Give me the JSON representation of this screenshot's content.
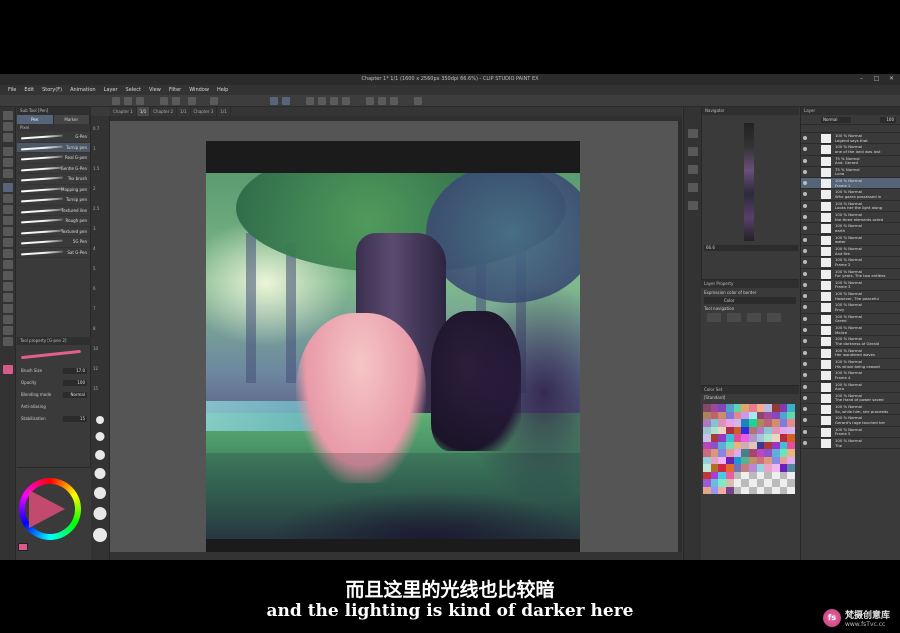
{
  "window": {
    "title": "Chapter 1* 1/1 (1600 x 2560px 350dpi 66.6%) - CLIP STUDIO PAINT EX"
  },
  "menu": [
    "File",
    "Edit",
    "Story(F)",
    "Animation",
    "Layer",
    "Select",
    "View",
    "Filter",
    "Window",
    "Help"
  ],
  "tabs": [
    "Chapter 1",
    "1/1",
    "Chapter 2",
    "1/1",
    "Chapter 3",
    "1/1"
  ],
  "subtool": {
    "header": "Sub Tool [Pen]",
    "tabs": [
      "Pen",
      "Marker"
    ],
    "group": "Pixel",
    "brushes": [
      "G-Pen",
      "Turnip pen",
      "Real G-pen",
      "Gentle G-Pen",
      "Tex brush",
      "Mapping pen",
      "Turnip pen",
      "Textured line",
      "Rough pen",
      "Textured pen",
      "5G Pen",
      "Sat G-Pen"
    ]
  },
  "tool_property": {
    "header": "Tool property [G-pen 2]",
    "brush_size_label": "Brush Size",
    "brush_size_value": "17.0",
    "opacity_label": "Opacity",
    "opacity_value": "100",
    "blending_label": "Blending mode",
    "blending_value": "Normal",
    "antialias_label": "Anti-aliasing",
    "stabilization_label": "Stabilization",
    "stabilization_value": "15"
  },
  "brush_sizes": [
    "0.7",
    "1",
    "1.5",
    "2",
    "2.5",
    "3",
    "4",
    "5",
    "6",
    "7",
    "8",
    "10",
    "12",
    "15"
  ],
  "navigator": {
    "header": "Navigator",
    "zoom": "66.6"
  },
  "layer_property": {
    "header": "Layer Property",
    "expression_label": "Expression color of border",
    "expression_value": "Color",
    "tool_nav_label": "Tool navigation"
  },
  "color_set": {
    "header": "Color Set",
    "name": "[Standard]"
  },
  "layers": {
    "header": "Layer",
    "blend": "Normal",
    "opacity": "100",
    "items": [
      {
        "line1": "100 % Normal",
        "line2": "Legend says that"
      },
      {
        "line1": "100 % Normal",
        "line2": "one of the land was lost"
      },
      {
        "line1": "75 % Normal",
        "line2": "And. Gerard"
      },
      {
        "line1": "75 % Normal",
        "line2": "Luna"
      },
      {
        "line1": "100 % Normal",
        "line2": "Frame 1"
      },
      {
        "line1": "100 % Normal",
        "line2": "Who gazes possessed in"
      },
      {
        "line1": "100 % Normal",
        "line2": "Looks her the light along"
      },
      {
        "line1": "100 % Normal",
        "line2": "the three elements acted"
      },
      {
        "line1": "100 % Normal",
        "line2": "earth"
      },
      {
        "line1": "100 % Normal",
        "line2": "water"
      },
      {
        "line1": "100 % Normal",
        "line2": "And fire"
      },
      {
        "line1": "100 % Normal",
        "line2": "Frame 2"
      },
      {
        "line1": "100 % Normal",
        "line2": "For years. The two entities"
      },
      {
        "line1": "100 % Normal",
        "line2": "Frame 3"
      },
      {
        "line1": "100 % Normal",
        "line2": "However, The peaceful"
      },
      {
        "line1": "100 % Normal",
        "line2": "Envy"
      },
      {
        "line1": "100 % Normal",
        "line2": "Greed"
      },
      {
        "line1": "100 % Normal",
        "line2": "Malice"
      },
      {
        "line1": "100 % Normal",
        "line2": "The darkness of Gerald"
      },
      {
        "line1": "100 % Normal",
        "line2": "Her wandered waves"
      },
      {
        "line1": "100 % Normal",
        "line2": "His whole being ceased"
      },
      {
        "line1": "100 % Normal",
        "line2": "Frame 4"
      },
      {
        "line1": "100 % Normal",
        "line2": "Aura"
      },
      {
        "line1": "100 % Normal",
        "line2": "The Hand of power saved"
      },
      {
        "line1": "100 % Normal",
        "line2": "So, while him, she proceeds"
      },
      {
        "line1": "100 % Normal",
        "line2": "Gerard's rage touched her"
      },
      {
        "line1": "100 % Normal",
        "line2": "Frame 5"
      },
      {
        "line1": "100 % Normal",
        "line2": "The"
      }
    ]
  },
  "subtitle": {
    "cn": "而且这里的光线也比较暗",
    "en": "and the lighting is kind of darker here"
  },
  "watermark": {
    "logo": "fs",
    "name": "梵摄创意库",
    "url": "www.fsTvc.cc"
  },
  "colors": {
    "accent": "#d85a8a",
    "panel": "#3a3a3a",
    "selection": "#556577"
  }
}
